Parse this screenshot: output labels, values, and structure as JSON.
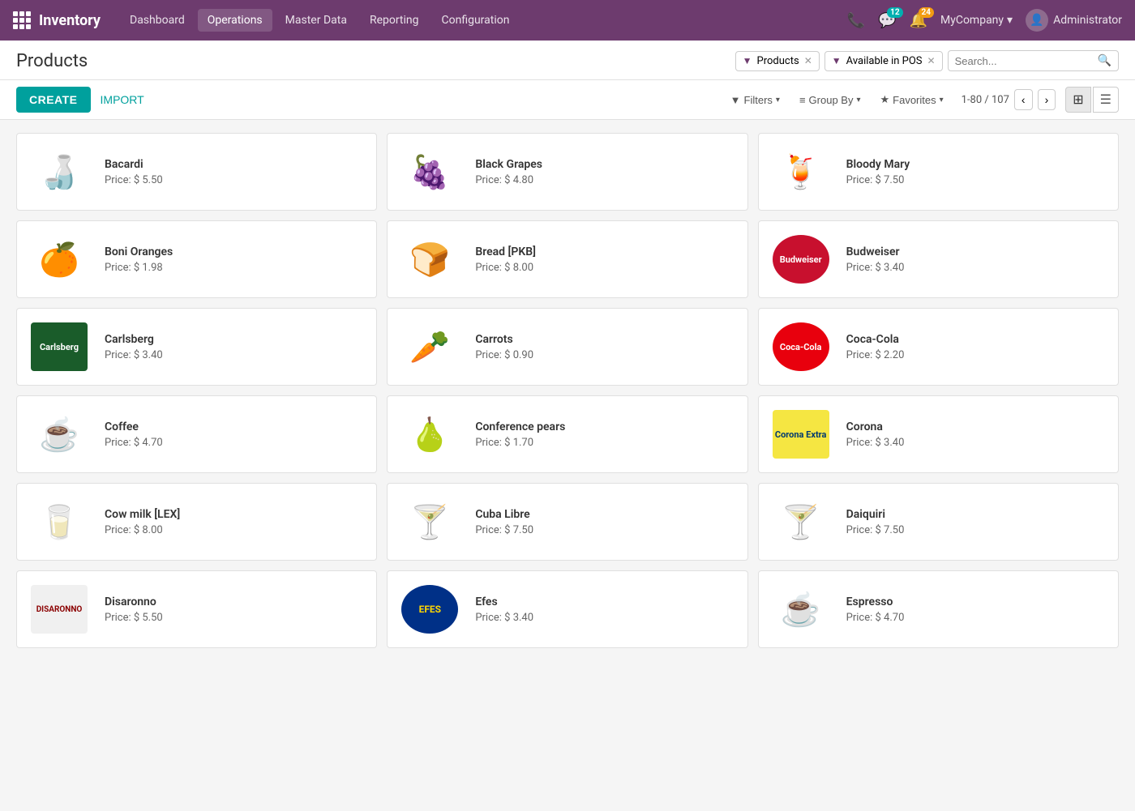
{
  "topnav": {
    "app_name": "Inventory",
    "links": [
      "Dashboard",
      "Operations",
      "Master Data",
      "Reporting",
      "Configuration"
    ],
    "badge1": "12",
    "badge2": "24",
    "company": "MyCompany",
    "admin": "Administrator"
  },
  "page": {
    "title": "Products",
    "create_label": "CREATE",
    "import_label": "IMPORT",
    "filter_tag1": "Products",
    "filter_tag2": "Available in POS",
    "search_placeholder": "Search...",
    "filters_label": "Filters",
    "groupby_label": "Group By",
    "favorites_label": "Favorites",
    "pagination": "1-80 / 107"
  },
  "products": [
    {
      "name": "Bacardi",
      "price": "Price: $ 5.50",
      "emoji": "🍶",
      "type": "bottle"
    },
    {
      "name": "Black Grapes",
      "price": "Price: $ 4.80",
      "emoji": "🍇",
      "type": "fruit"
    },
    {
      "name": "Bloody Mary",
      "price": "Price: $ 7.50",
      "emoji": "🍹",
      "type": "cocktail"
    },
    {
      "name": "Boni Oranges",
      "price": "Price: $ 1.98",
      "emoji": "🍊",
      "type": "fruit"
    },
    {
      "name": "Bread [PKB]",
      "price": "Price: $ 8.00",
      "emoji": "🍞",
      "type": "food"
    },
    {
      "name": "Budweiser",
      "price": "Price: $ 3.40",
      "emoji": "🍺",
      "type": "beer-budweiser"
    },
    {
      "name": "Carlsberg",
      "price": "Price: $ 3.40",
      "emoji": "🍺",
      "type": "beer-carlsberg"
    },
    {
      "name": "Carrots",
      "price": "Price: $ 0.90",
      "emoji": "🥕",
      "type": "vegetable"
    },
    {
      "name": "Coca-Cola",
      "price": "Price: $ 2.20",
      "emoji": "🥤",
      "type": "cocacola"
    },
    {
      "name": "Coffee",
      "price": "Price: $ 4.70",
      "emoji": "☕",
      "type": "drink"
    },
    {
      "name": "Conference pears",
      "price": "Price: $ 1.70",
      "emoji": "🍐",
      "type": "fruit"
    },
    {
      "name": "Corona",
      "price": "Price: $ 3.40",
      "emoji": "🍺",
      "type": "beer-corona"
    },
    {
      "name": "Cow milk [LEX]",
      "price": "Price: $ 8.00",
      "emoji": "🥛",
      "type": "dairy"
    },
    {
      "name": "Cuba Libre",
      "price": "Price: $ 7.50",
      "emoji": "🍸",
      "type": "cocktail"
    },
    {
      "name": "Daiquiri",
      "price": "Price: $ 7.50",
      "emoji": "🍸",
      "type": "cocktail"
    },
    {
      "name": "Disaronno",
      "price": "Price: $ 5.50",
      "emoji": "🍾",
      "type": "disaronno"
    },
    {
      "name": "Efes",
      "price": "Price: $ 3.40",
      "emoji": "🍺",
      "type": "efes"
    },
    {
      "name": "Espresso",
      "price": "Price: $ 4.70",
      "emoji": "☕",
      "type": "drink"
    }
  ]
}
